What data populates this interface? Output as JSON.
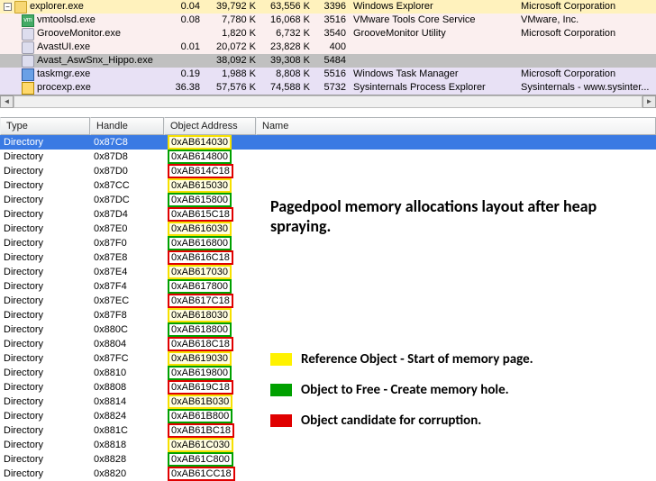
{
  "processes": [
    {
      "bg": "bg-explorer",
      "indent": 0,
      "expander": "−",
      "icon": "icon-folder",
      "name": "explorer.exe",
      "cpu": "0.04",
      "priv": "39,792 K",
      "ws": "63,556 K",
      "pid": "3396",
      "desc": "Windows Explorer",
      "comp": "Microsoft Corporation"
    },
    {
      "bg": "bg-vm",
      "indent": 1,
      "expander": "",
      "icon": "icon-vm",
      "iconTxt": "vm",
      "name": "vmtoolsd.exe",
      "cpu": "0.08",
      "priv": "7,780 K",
      "ws": "16,068 K",
      "pid": "3516",
      "desc": "VMware Tools Core Service",
      "comp": "VMware, Inc."
    },
    {
      "bg": "bg-groove",
      "indent": 1,
      "expander": "",
      "icon": "icon-app",
      "name": "GrooveMonitor.exe",
      "cpu": "",
      "priv": "1,820 K",
      "ws": "6,732 K",
      "pid": "3540",
      "desc": "GrooveMonitor Utility",
      "comp": "Microsoft Corporation"
    },
    {
      "bg": "bg-avastui",
      "indent": 1,
      "expander": "",
      "icon": "icon-app",
      "name": "AvastUI.exe",
      "cpu": "0.01",
      "priv": "20,072 K",
      "ws": "23,828 K",
      "pid": "400",
      "desc": "",
      "comp": ""
    },
    {
      "bg": "bg-hippo",
      "indent": 1,
      "expander": "",
      "icon": "icon-app",
      "name": "Avast_AswSnx_Hippo.exe",
      "cpu": "",
      "priv": "38,092 K",
      "ws": "39,308 K",
      "pid": "5484",
      "desc": "",
      "comp": ""
    },
    {
      "bg": "bg-task",
      "indent": 1,
      "expander": "",
      "icon": "icon-blue",
      "name": "taskmgr.exe",
      "cpu": "0.19",
      "priv": "1,988 K",
      "ws": "8,808 K",
      "pid": "5516",
      "desc": "Windows Task Manager",
      "comp": "Microsoft Corporation"
    },
    {
      "bg": "bg-proc",
      "indent": 1,
      "expander": "",
      "icon": "icon-proc",
      "name": "procexp.exe",
      "cpu": "36.38",
      "priv": "57,576 K",
      "ws": "74,588 K",
      "pid": "5732",
      "desc": "Sysinternals Process Explorer",
      "comp": "Sysinternals - www.sysinter..."
    }
  ],
  "hheaders": {
    "type": "Type",
    "handle": "Handle",
    "addr": "Object Address",
    "name": "Name"
  },
  "handles": [
    {
      "type": "Directory",
      "handle": "0x87C8",
      "addr": "0xAB614030",
      "cls": "b-yellow",
      "sel": true
    },
    {
      "type": "Directory",
      "handle": "0x87D8",
      "addr": "0xAB614800",
      "cls": "b-green"
    },
    {
      "type": "Directory",
      "handle": "0x87D0",
      "addr": "0xAB614C18",
      "cls": "b-red"
    },
    {
      "type": "Directory",
      "handle": "0x87CC",
      "addr": "0xAB615030",
      "cls": "b-yellow"
    },
    {
      "type": "Directory",
      "handle": "0x87DC",
      "addr": "0xAB615800",
      "cls": "b-green"
    },
    {
      "type": "Directory",
      "handle": "0x87D4",
      "addr": "0xAB615C18",
      "cls": "b-red"
    },
    {
      "type": "Directory",
      "handle": "0x87E0",
      "addr": "0xAB616030",
      "cls": "b-yellow"
    },
    {
      "type": "Directory",
      "handle": "0x87F0",
      "addr": "0xAB616800",
      "cls": "b-green"
    },
    {
      "type": "Directory",
      "handle": "0x87E8",
      "addr": "0xAB616C18",
      "cls": "b-red"
    },
    {
      "type": "Directory",
      "handle": "0x87E4",
      "addr": "0xAB617030",
      "cls": "b-yellow"
    },
    {
      "type": "Directory",
      "handle": "0x87F4",
      "addr": "0xAB617800",
      "cls": "b-green"
    },
    {
      "type": "Directory",
      "handle": "0x87EC",
      "addr": "0xAB617C18",
      "cls": "b-red"
    },
    {
      "type": "Directory",
      "handle": "0x87F8",
      "addr": "0xAB618030",
      "cls": "b-yellow"
    },
    {
      "type": "Directory",
      "handle": "0x880C",
      "addr": "0xAB618800",
      "cls": "b-green"
    },
    {
      "type": "Directory",
      "handle": "0x8804",
      "addr": "0xAB618C18",
      "cls": "b-red"
    },
    {
      "type": "Directory",
      "handle": "0x87FC",
      "addr": "0xAB619030",
      "cls": "b-yellow"
    },
    {
      "type": "Directory",
      "handle": "0x8810",
      "addr": "0xAB619800",
      "cls": "b-green"
    },
    {
      "type": "Directory",
      "handle": "0x8808",
      "addr": "0xAB619C18",
      "cls": "b-red"
    },
    {
      "type": "Directory",
      "handle": "0x8814",
      "addr": "0xAB61B030",
      "cls": "b-yellow"
    },
    {
      "type": "Directory",
      "handle": "0x8824",
      "addr": "0xAB61B800",
      "cls": "b-green"
    },
    {
      "type": "Directory",
      "handle": "0x881C",
      "addr": "0xAB61BC18",
      "cls": "b-red"
    },
    {
      "type": "Directory",
      "handle": "0x8818",
      "addr": "0xAB61C030",
      "cls": "b-yellow"
    },
    {
      "type": "Directory",
      "handle": "0x8828",
      "addr": "0xAB61C800",
      "cls": "b-green"
    },
    {
      "type": "Directory",
      "handle": "0x8820",
      "addr": "0xAB61CC18",
      "cls": "b-red"
    }
  ],
  "overlay": {
    "title": "Pagedpool memory allocations layout after heap spraying.",
    "leg1": "Reference Object - Start of memory page.",
    "leg2": "Object to Free - Create memory hole.",
    "leg3": "Object candidate for corruption."
  }
}
